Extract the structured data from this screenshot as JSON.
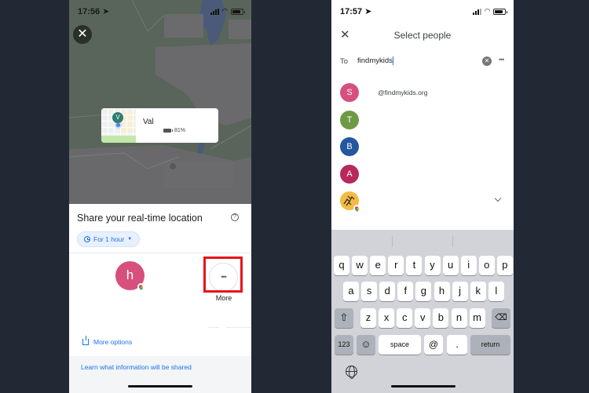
{
  "left_screen": {
    "status_bar": {
      "time": "17:56",
      "location_arrow": true
    },
    "map": {
      "close_icon": "close-icon",
      "location_card": {
        "pin_initial": "V",
        "name": "Val",
        "battery_percent": "81%",
        "battery_level": 0.81
      }
    },
    "share_sheet": {
      "title": "Share your real-time location",
      "help_icon": "help-circle-icon",
      "duration_chip": "For 1 hour",
      "contacts": [
        {
          "initial": "h",
          "color": "#d64f7d",
          "badge": "google-maps-badge"
        }
      ],
      "more_button": {
        "label": "More",
        "icon": "ellipsis-icon",
        "highlighted": true,
        "highlight_color": "#e8121b"
      },
      "more_options_label": "More options",
      "learn_link": "Learn what information will be shared"
    }
  },
  "right_screen": {
    "status_bar": {
      "time": "17:57",
      "location_arrow": true
    },
    "header": {
      "title": "Select people",
      "close_icon": "close-icon"
    },
    "to_field": {
      "label": "To",
      "value": "findmykids",
      "clear_icon": "clear-icon",
      "more_icon": "ellipsis-icon"
    },
    "suggestions": [
      {
        "initial": "S",
        "color": "#d64f7d",
        "detail": "@findmykids.org"
      },
      {
        "initial": "T",
        "color": "#6f9a45",
        "detail": ""
      },
      {
        "initial": "B",
        "color": "#2357a0",
        "detail": ""
      },
      {
        "initial": "A",
        "color": "#b8285b",
        "detail": ""
      },
      {
        "initial": "",
        "color": "#f4bb42",
        "detail": "",
        "image_avatar": true,
        "badge": "google-maps-badge",
        "expand_icon": "chevron-down-icon"
      }
    ],
    "keyboard": {
      "row1": [
        "q",
        "w",
        "e",
        "r",
        "t",
        "y",
        "u",
        "i",
        "o",
        "p"
      ],
      "row2": [
        "a",
        "s",
        "d",
        "f",
        "g",
        "h",
        "j",
        "k",
        "l"
      ],
      "row3": [
        "z",
        "x",
        "c",
        "v",
        "b",
        "n",
        "m"
      ],
      "shift": "⇧",
      "backspace": "⌫",
      "numbers": "123",
      "emoji": "☺",
      "space": "space",
      "at": "@",
      "dot": ".",
      "return": "return",
      "globe_icon": "globe-icon"
    }
  }
}
